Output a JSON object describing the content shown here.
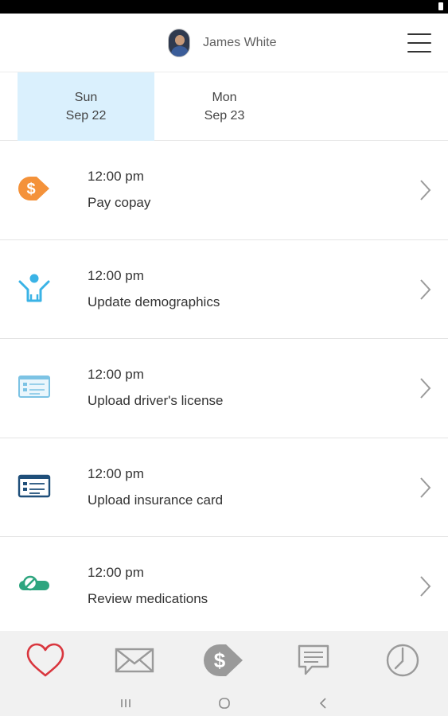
{
  "header": {
    "user_name": "James White",
    "avatar_icon": "user-avatar",
    "menu_icon": "hamburger-icon"
  },
  "dates": [
    {
      "day": "Sun",
      "date": "Sep 22",
      "selected": true
    },
    {
      "day": "Mon",
      "date": "Sep 23",
      "selected": false
    }
  ],
  "tasks": [
    {
      "time": "12:00 pm",
      "label": "Pay copay",
      "icon": "dollar-tag-icon"
    },
    {
      "time": "12:00 pm",
      "label": "Update demographics",
      "icon": "person-icon"
    },
    {
      "time": "12:00 pm",
      "label": "Upload driver's license",
      "icon": "id-card-icon"
    },
    {
      "time": "12:00 pm",
      "label": "Upload insurance card",
      "icon": "insurance-card-icon"
    },
    {
      "time": "12:00 pm",
      "label": "Review medications",
      "icon": "pill-icon"
    }
  ],
  "bottom_nav": [
    {
      "icon": "heart-icon",
      "active": true
    },
    {
      "icon": "mail-icon",
      "active": false
    },
    {
      "icon": "dollar-tag-icon",
      "active": false
    },
    {
      "icon": "chat-icon",
      "active": false
    },
    {
      "icon": "clock-icon",
      "active": false
    }
  ],
  "system_nav": [
    "recents-icon",
    "home-icon",
    "back-icon"
  ],
  "colors": {
    "selected_date_bg": "#daf0fd",
    "copay_orange": "#f4923a",
    "demographics_blue": "#3ab3e6",
    "license_blue": "#7cc3e4",
    "insurance_navy": "#1f4f7a",
    "medication_green": "#2ea57f",
    "heart_red": "#d9363e",
    "nav_gray": "#9a9a9a"
  }
}
